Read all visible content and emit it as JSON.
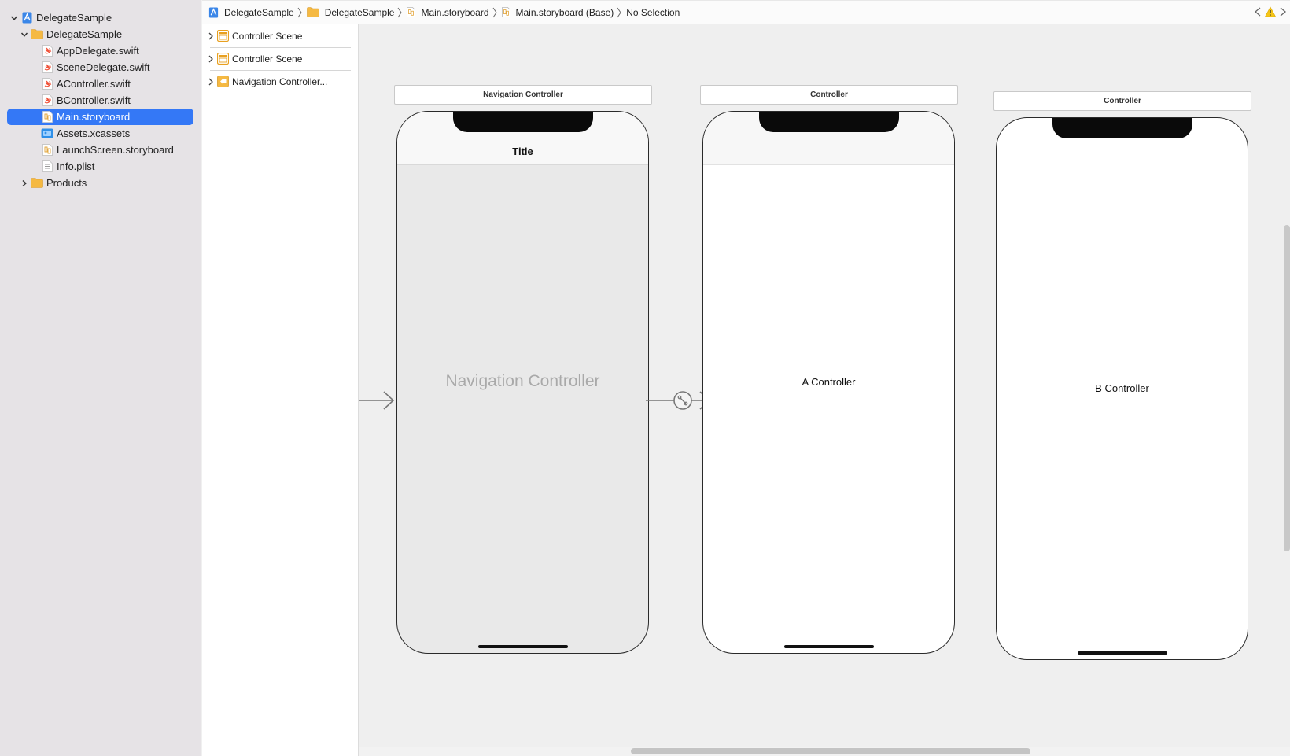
{
  "navigator": {
    "project_name": "DelegateSample",
    "group_name": "DelegateSample",
    "files": [
      {
        "label": "AppDelegate.swift",
        "icon": "swift-file-icon"
      },
      {
        "label": "SceneDelegate.swift",
        "icon": "swift-file-icon"
      },
      {
        "label": "AController.swift",
        "icon": "swift-file-icon"
      },
      {
        "label": "BController.swift",
        "icon": "swift-file-icon"
      },
      {
        "label": "Main.storyboard",
        "icon": "storyboard-file-icon",
        "selected": true
      },
      {
        "label": "Assets.xcassets",
        "icon": "asset-catalog-icon"
      },
      {
        "label": "LaunchScreen.storyboard",
        "icon": "storyboard-file-icon"
      },
      {
        "label": "Info.plist",
        "icon": "plist-file-icon"
      }
    ],
    "products_label": "Products",
    "selection_color": "#3478f6"
  },
  "jumpbar": {
    "crumbs": [
      "DelegateSample",
      "DelegateSample",
      "Main.storyboard",
      "Main.storyboard (Base)",
      "No Selection"
    ]
  },
  "outline": {
    "scenes": [
      "Controller Scene",
      "Controller Scene",
      "Navigation Controller..."
    ]
  },
  "canvas": {
    "scenes": [
      {
        "title": "Navigation Controller",
        "navbar_title": "Title",
        "center_label": "Navigation Controller"
      },
      {
        "title": "Controller",
        "center_label": "A Controller"
      },
      {
        "title": "Controller",
        "center_label": "B Controller"
      }
    ]
  },
  "colors": {
    "accent": "#3478f6",
    "folder": "#f5b942",
    "swift": "#f05138",
    "warning": "#f5c518"
  }
}
